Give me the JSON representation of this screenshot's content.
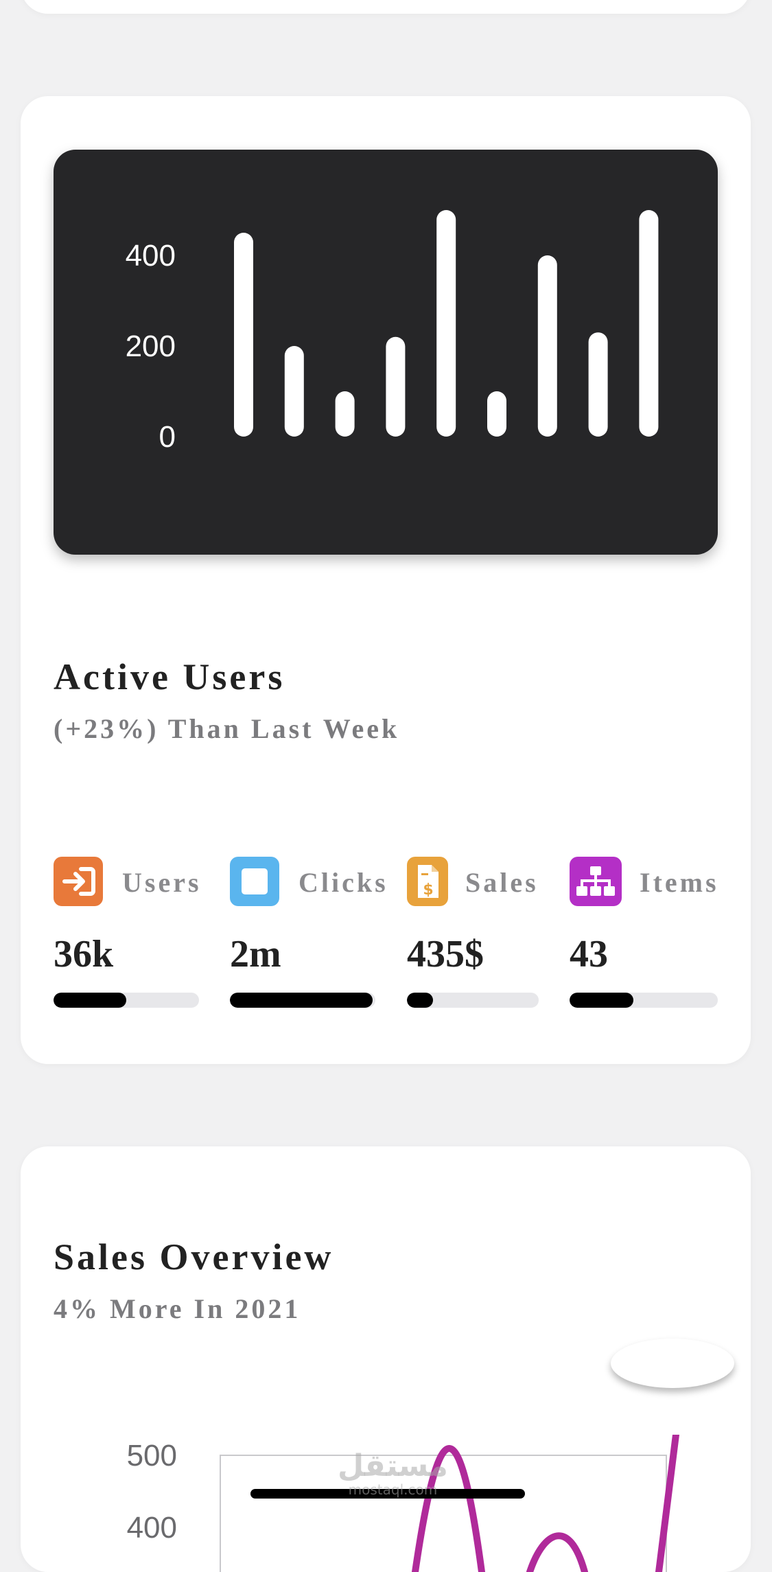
{
  "active_users_card": {
    "title": "Active Users",
    "subtitle": "(+23%) Than Last Week",
    "chart_data": {
      "type": "bar",
      "y_ticks": [
        "0",
        "200",
        "400"
      ],
      "ylim": [
        0,
        500
      ],
      "values": [
        450,
        200,
        100,
        220,
        500,
        100,
        400,
        230,
        500
      ],
      "bar_color": "#ffffff",
      "background_color": "#262628"
    },
    "stats": [
      {
        "label": "Users",
        "value": "36k",
        "progress": 0.5,
        "icon": "login-icon",
        "icon_color": "#e8793a"
      },
      {
        "label": "Clicks",
        "value": "2m",
        "progress": 0.98,
        "icon": "square-icon",
        "icon_color": "#5ab5ee"
      },
      {
        "label": "Sales",
        "value": "435$",
        "progress": 0.2,
        "icon": "invoice-dollar-icon",
        "icon_color": "#e8a23b"
      },
      {
        "label": "Items",
        "value": "43",
        "progress": 0.43,
        "icon": "sitemap-icon",
        "icon_color": "#b42fc6"
      }
    ]
  },
  "sales_overview_card": {
    "title": "Sales Overview",
    "subtitle": "4% More In 2021",
    "chart_data": {
      "type": "line",
      "y_ticks_visible": [
        "500"
      ],
      "series_color": "#b02a9a"
    },
    "watermark": {
      "main": "مستقل",
      "sub": "mostaql.com"
    }
  }
}
